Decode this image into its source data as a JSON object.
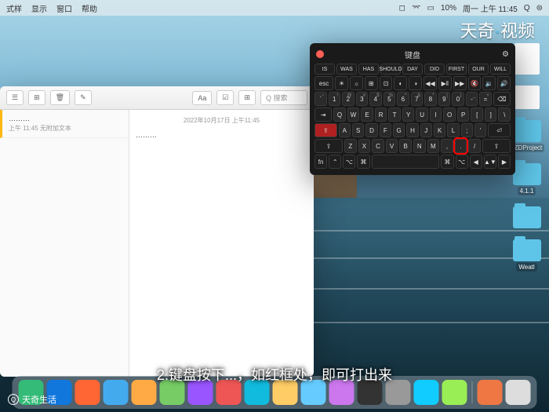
{
  "menubar": {
    "items": [
      "式样",
      "显示",
      "窗口",
      "帮助"
    ],
    "status": "10%",
    "time": "周一 上午 11:45"
  },
  "watermark_top": {
    "brand": "天奇",
    "sep": "·",
    "word": "视频"
  },
  "watermark_bottom": "天奇生活",
  "desktop": {
    "folders": [
      "JZDProject",
      "4.1.1",
      "Weatl"
    ]
  },
  "notes": {
    "toolbar": {
      "aa": "Aa",
      "search": "Q 搜索"
    },
    "sidebar": {
      "item_title": "………",
      "item_time": "上午 11:45",
      "item_sub": "无附加文本"
    },
    "content": {
      "date": "2022年10月17日 上午11:45",
      "text": "………"
    }
  },
  "keyboard": {
    "title": "键盘",
    "suggestions": [
      "IS",
      "WAS",
      "HAS",
      "SHOULD",
      "DAY",
      "DID",
      "FIRST",
      "OUR",
      "WILL"
    ],
    "fn_row": [
      "esc",
      "☀",
      "☼",
      "⊞",
      "⊡",
      "◐",
      "◑",
      "◀◀",
      "▶‖",
      "▶▶",
      "🔇",
      "🔉",
      "🔊"
    ],
    "num_row": [
      {
        "k": "`",
        "s": "~"
      },
      {
        "k": "1",
        "s": "!"
      },
      {
        "k": "2",
        "s": "@"
      },
      {
        "k": "3",
        "s": "#"
      },
      {
        "k": "4",
        "s": "$"
      },
      {
        "k": "5",
        "s": "%"
      },
      {
        "k": "6",
        "s": "^"
      },
      {
        "k": "7",
        "s": "&"
      },
      {
        "k": "8",
        "s": "*"
      },
      {
        "k": "9",
        "s": "("
      },
      {
        "k": "0",
        "s": ")"
      },
      {
        "k": "-",
        "s": "_"
      },
      {
        "k": "=",
        "s": "+"
      },
      {
        "k": "⌫",
        "s": ""
      }
    ],
    "q_row": [
      "⇥",
      "Q",
      "W",
      "E",
      "R",
      "T",
      "Y",
      "U",
      "I",
      "O",
      "P",
      "[",
      "]",
      "\\"
    ],
    "a_row": [
      "⇪",
      "A",
      "S",
      "D",
      "F",
      "G",
      "H",
      "J",
      "K",
      "L",
      ";",
      "'",
      "⏎"
    ],
    "z_row": [
      "⇧",
      "Z",
      "X",
      "C",
      "V",
      "B",
      "N",
      "M",
      ",",
      ".",
      "/",
      "⇧"
    ],
    "space_row": [
      "fn",
      "⌃",
      "⌥",
      "⌘",
      "",
      "⌘",
      "⌥",
      "◀",
      "▲▼",
      "▶"
    ]
  },
  "subtitle": "2.键盘按下...，如红框处，即可打出来",
  "dock_count": 18
}
